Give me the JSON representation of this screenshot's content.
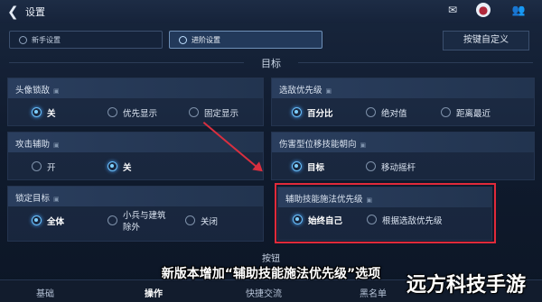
{
  "header": {
    "title": "设置"
  },
  "tabs": [
    {
      "label": "新手设置"
    },
    {
      "label": "进阶设置"
    }
  ],
  "keybind_button": "按键自定义",
  "section_target": "目标",
  "cards": {
    "avatar_lock": {
      "title": "头像锁敌",
      "options": [
        "关",
        "优先显示",
        "固定显示"
      ]
    },
    "select_priority": {
      "title": "选敌优先级",
      "options": [
        "百分比",
        "绝对值",
        "距离最近"
      ]
    },
    "attack_assist": {
      "title": "攻击辅助",
      "options": [
        "开",
        "关"
      ]
    },
    "damage_skill_direction": {
      "title": "伤害型位移技能朝向",
      "options": [
        "目标",
        "移动摇杆"
      ]
    },
    "lock_target": {
      "title": "锁定目标",
      "options": [
        "全体",
        "小兵与建筑",
        "除外",
        "关闭"
      ]
    },
    "assist_skill_priority": {
      "title": "辅助技能施法优先级",
      "options": [
        "始终自己",
        "根据选敌优先级"
      ]
    }
  },
  "section_buttons": "按钮",
  "caption": "新版本增加“辅助技能施法优先级”选项",
  "bottom_tabs": [
    "基础",
    "操作",
    "快捷交流",
    "黑名单"
  ],
  "watermark": "远方科技手游"
}
